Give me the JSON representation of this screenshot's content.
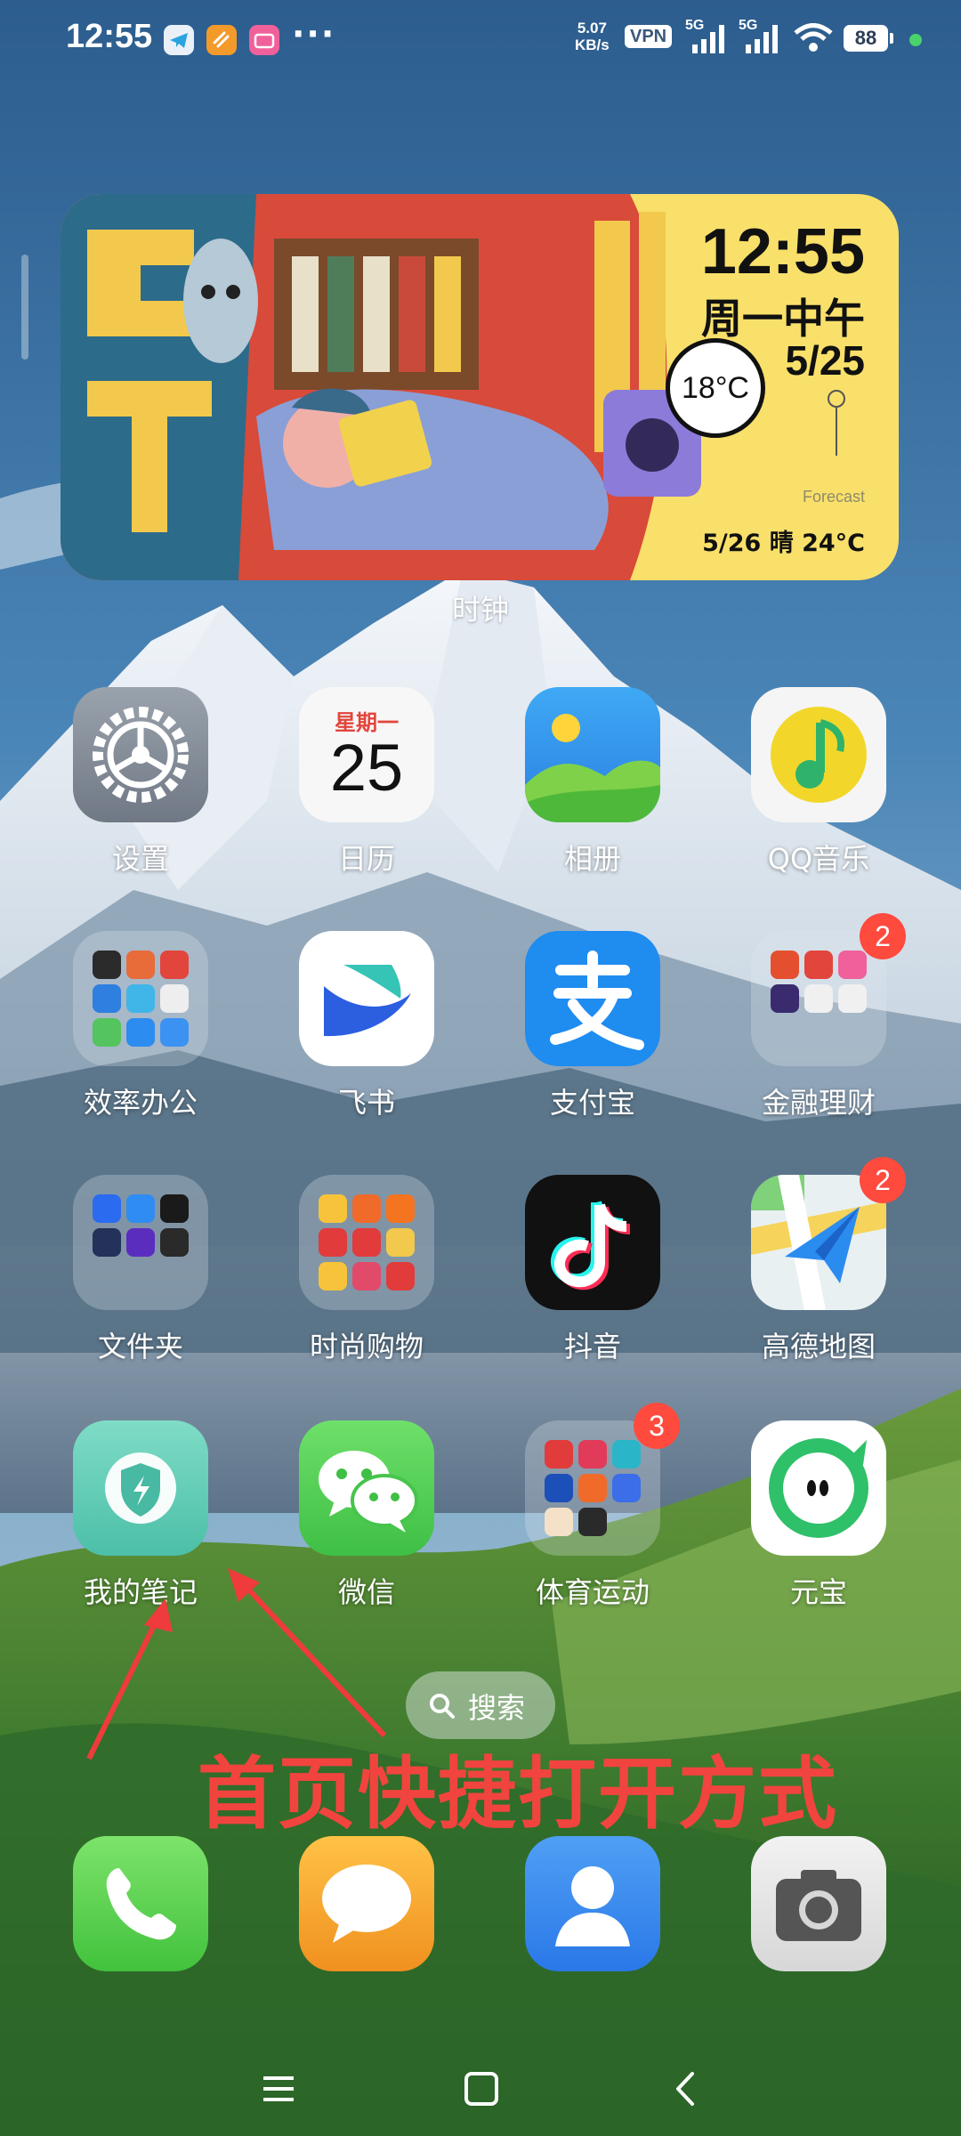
{
  "status_bar": {
    "time": "12:55",
    "net_speed_value": "5.07",
    "net_speed_unit": "KB/s",
    "vpn": "VPN",
    "signal1": "5G",
    "signal2": "5G",
    "battery": "88"
  },
  "clock_widget": {
    "time": "12:55",
    "day": "周一中午",
    "date": "5/25",
    "temperature": "18°C",
    "forecast_label": "Forecast",
    "forecast": "5/26 晴 24°C",
    "label": "时钟"
  },
  "apps": {
    "settings": {
      "label": "设置"
    },
    "calendar": {
      "label": "日历",
      "weekday": "星期一",
      "date": "25"
    },
    "photos": {
      "label": "相册"
    },
    "qq_music": {
      "label": "QQ音乐"
    },
    "efficiency_folder": {
      "label": "效率办公"
    },
    "feishu": {
      "label": "飞书"
    },
    "alipay": {
      "label": "支付宝"
    },
    "finance_folder": {
      "label": "金融理财",
      "badge": "2"
    },
    "files_folder": {
      "label": "文件夹"
    },
    "shopping_folder": {
      "label": "时尚购物"
    },
    "douyin": {
      "label": "抖音"
    },
    "amap": {
      "label": "高德地图",
      "badge": "2"
    },
    "my_notes": {
      "label": "我的笔记"
    },
    "wechat": {
      "label": "微信"
    },
    "sports_folder": {
      "label": "体育运动",
      "badge": "3"
    },
    "yuanbao": {
      "label": "元宝"
    }
  },
  "search": {
    "label": "搜索"
  },
  "annotation": {
    "text": "首页快捷打开方式",
    "color": "#f1443e"
  },
  "dock": [
    "phone-app",
    "messages-app",
    "contacts-app",
    "camera-app"
  ],
  "colors": {
    "badge": "#ff4a3e",
    "widget_bg": "#f9e06a"
  }
}
